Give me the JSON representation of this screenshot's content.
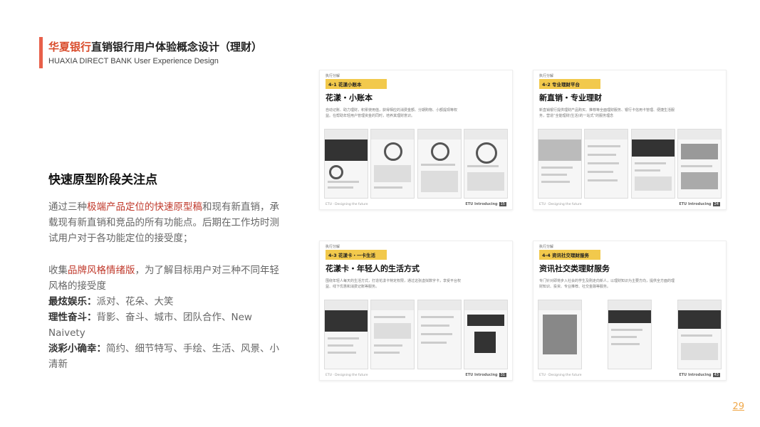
{
  "header": {
    "title_brand": "华夏银行",
    "title_rest": "直销银行用户体验概念设计（理财）",
    "subtitle": "HUAXIA DIRECT BANK User Experience Design"
  },
  "section": {
    "heading": "快速原型阶段关注点",
    "p1_a": "通过三种",
    "p1_red": "极端产品定位的快速原型稿",
    "p1_b": "和现有新直销，承载现有新直销和竞品的所有功能点。后期在工作坊时测试用户对于各功能定位的接受度；",
    "p2_a": "收集",
    "p2_red": "品牌风格情绪版",
    "p2_b": "，为了解目标用户对三种不同年轻风格的接受度",
    "styles": [
      {
        "k": "最炫娱乐：",
        "v": "派对、花朵、大笑"
      },
      {
        "k": "理性奋斗：",
        "v": "背影、奋斗、城市、团队合作、New Naivety"
      },
      {
        "k": "淡彩小确幸：",
        "v": "简约、细节特写、手绘、生活、风景、小清新"
      }
    ]
  },
  "cards": [
    {
      "tiny": "执行分解",
      "tag": "4-1 花漾小账本",
      "title": "花漾・小账本",
      "desc": "自动记账、助力理财，积累使用值，获得相应的消费金额、分期购物、小额提现等权益。在帮助年轻用户管理资金的同时，培养其理财意识。",
      "foot_l": "ETU · Designing the future",
      "foot_r": "ETU Introducing",
      "num": "15"
    },
    {
      "tiny": "执行分解",
      "tag": "4-2 专业理财平台",
      "title": "新直销・专业理财",
      "desc": "新直销银行提供理财产品购买、推荐等全面理财服务、银行卡信用卡管理、便捷生活服务，营造“全能理财(生活)的一站式”的服务理念",
      "foot_l": "ETU · Designing the future",
      "foot_r": "ETU Introducing",
      "num": "24"
    },
    {
      "tiny": "执行分解",
      "tag": "4-3 花漾卡・一卡生活",
      "title": "花漾卡・年轻人的生活方式",
      "desc": "围绕年轻人每天的生活方式，打造花漾卡特定权限，通过这张虚拟数字卡，享受平台权益、线下优惠和消费记账等服务。",
      "foot_l": "ETU · Designing the future",
      "foot_r": "ETU Introducing",
      "num": "31"
    },
    {
      "tiny": "执行分解",
      "tag": "4-4 资讯社交理财服务",
      "title": "资讯社交类理财服务",
      "desc": "专门针对即将步入社会的学生及刚走向新人，以理财知识为主要方向，提供全方面的理财知识、投资、专业推荐、社交金融等服务。",
      "foot_l": "ETU · Designing the future",
      "foot_r": "ETU Introducing",
      "num": "43"
    }
  ],
  "page_number": "29"
}
